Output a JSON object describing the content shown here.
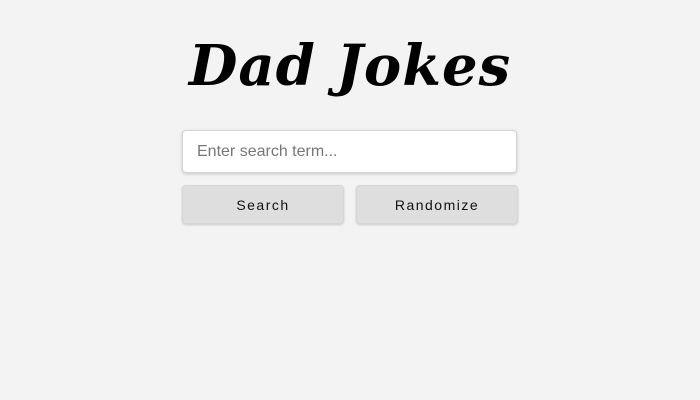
{
  "app": {
    "title": "Dad Jokes"
  },
  "search": {
    "placeholder": "Enter search term...",
    "value": ""
  },
  "buttons": {
    "search_label": "Search",
    "randomize_label": "Randomize"
  },
  "colors": {
    "background": "#f3f3f3",
    "button_bg": "#dedede",
    "input_bg": "#ffffff",
    "text": "#000000"
  }
}
